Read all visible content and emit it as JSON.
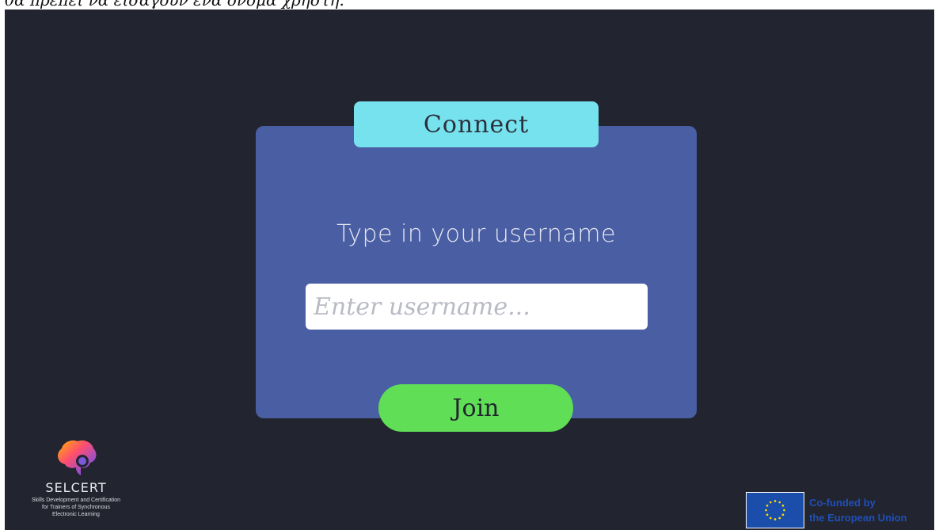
{
  "caption": {
    "text": "θα πρέπει να εισάγουν ένα όνομα χρήστη."
  },
  "connect_panel": {
    "title": "Connect",
    "prompt": "Type in your username",
    "username_placeholder": "Enter username...",
    "username_value": "",
    "join_label": "Join"
  },
  "branding": {
    "logo_name": "SELCERT",
    "tagline_line1": "Skills Development and Certification",
    "tagline_line2": "for Trainers of Synchronous",
    "tagline_line3": "Electronic Learning",
    "eu_line1": "Co-funded by",
    "eu_line2": "the European Union",
    "logo_icon": "brain-icon",
    "eu_icon": "eu-flag-icon"
  },
  "colors": {
    "background": "#22252f",
    "panel": "#4a5ea3",
    "title_tab": "#76e2ee",
    "join_button": "#5fde56",
    "eu_blue": "#1b4dab"
  }
}
